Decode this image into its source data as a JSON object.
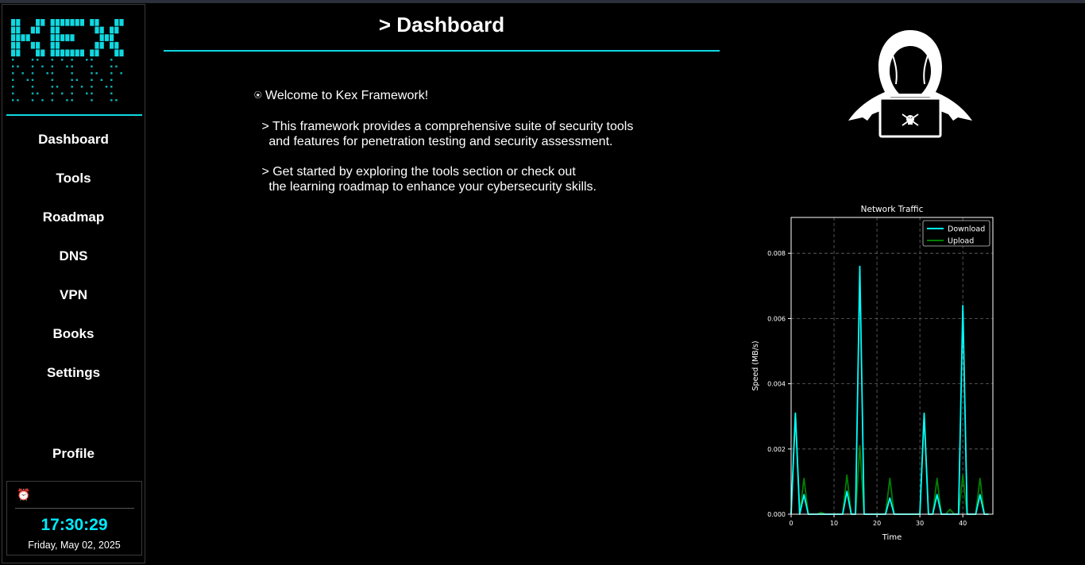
{
  "sidebar": {
    "logo_text": "KEX",
    "nav": [
      {
        "label": "Dashboard"
      },
      {
        "label": "Tools"
      },
      {
        "label": "Roadmap"
      },
      {
        "label": "DNS"
      },
      {
        "label": "VPN"
      },
      {
        "label": "Books"
      },
      {
        "label": "Settings"
      }
    ],
    "profile_label": "Profile",
    "clock": {
      "icon": "alarm-clock-icon",
      "time": "17:30:29",
      "date": "Friday, May 02, 2025"
    }
  },
  "main": {
    "title": "> Dashboard",
    "welcome": "⍟ Welcome to Kex Framework!",
    "paragraph1": " > This framework provides a comprehensive suite of security tools\n   and features for penetration testing and security assessment.",
    "paragraph2": " > Get started by exploring the tools section or check out\n   the learning roadmap to enhance your cybersecurity skills."
  },
  "colors": {
    "accent": "#10d8e0",
    "download": "#00ffff",
    "upload": "#008000",
    "background": "#000000"
  },
  "chart_data": {
    "type": "line",
    "title": "Network Traffic",
    "xlabel": "Time",
    "ylabel": "Speed (MB/s)",
    "xlim": [
      0,
      47
    ],
    "ylim": [
      0,
      0.0091
    ],
    "xticks": [
      0,
      10,
      20,
      30,
      40
    ],
    "yticks": [
      0.0,
      0.002,
      0.004,
      0.006,
      0.008
    ],
    "ytick_labels": [
      "0.000",
      "0.002",
      "0.004",
      "0.006",
      "0.008"
    ],
    "grid": true,
    "legend": "top-right",
    "x": [
      0,
      1,
      2,
      3,
      4,
      5,
      6,
      7,
      8,
      9,
      10,
      11,
      12,
      13,
      14,
      15,
      16,
      17,
      18,
      19,
      20,
      21,
      22,
      23,
      24,
      25,
      26,
      27,
      28,
      29,
      30,
      31,
      32,
      33,
      34,
      35,
      36,
      37,
      38,
      39,
      40,
      41,
      42,
      43,
      44,
      45,
      46
    ],
    "series": [
      {
        "name": "Download",
        "color": "#00ffff",
        "values": [
          0,
          0.0031,
          0,
          0.0006,
          0,
          0,
          0,
          0,
          0,
          0,
          0,
          0,
          0,
          0.0007,
          0,
          0,
          0.0076,
          0,
          0,
          0,
          0,
          0,
          0,
          0.0005,
          0,
          0,
          0,
          0,
          0,
          0,
          0,
          0.0031,
          0,
          0,
          0.0006,
          0,
          0,
          0,
          0,
          0,
          0.0064,
          0,
          0,
          0,
          0.0006,
          0,
          0
        ]
      },
      {
        "name": "Upload",
        "color": "#008000",
        "values": [
          0,
          0.0031,
          0,
          0.0011,
          0,
          0,
          0,
          5e-05,
          0,
          0,
          0,
          0,
          0,
          0.0012,
          0,
          0,
          0.0021,
          0,
          0,
          0,
          0,
          0,
          0,
          0.0011,
          0,
          0,
          0,
          0,
          0,
          0,
          0,
          0.003,
          0,
          0,
          0.0011,
          0,
          0,
          0.00015,
          0,
          0,
          0.0012,
          0,
          0,
          0,
          0.0011,
          0,
          0
        ]
      }
    ]
  }
}
